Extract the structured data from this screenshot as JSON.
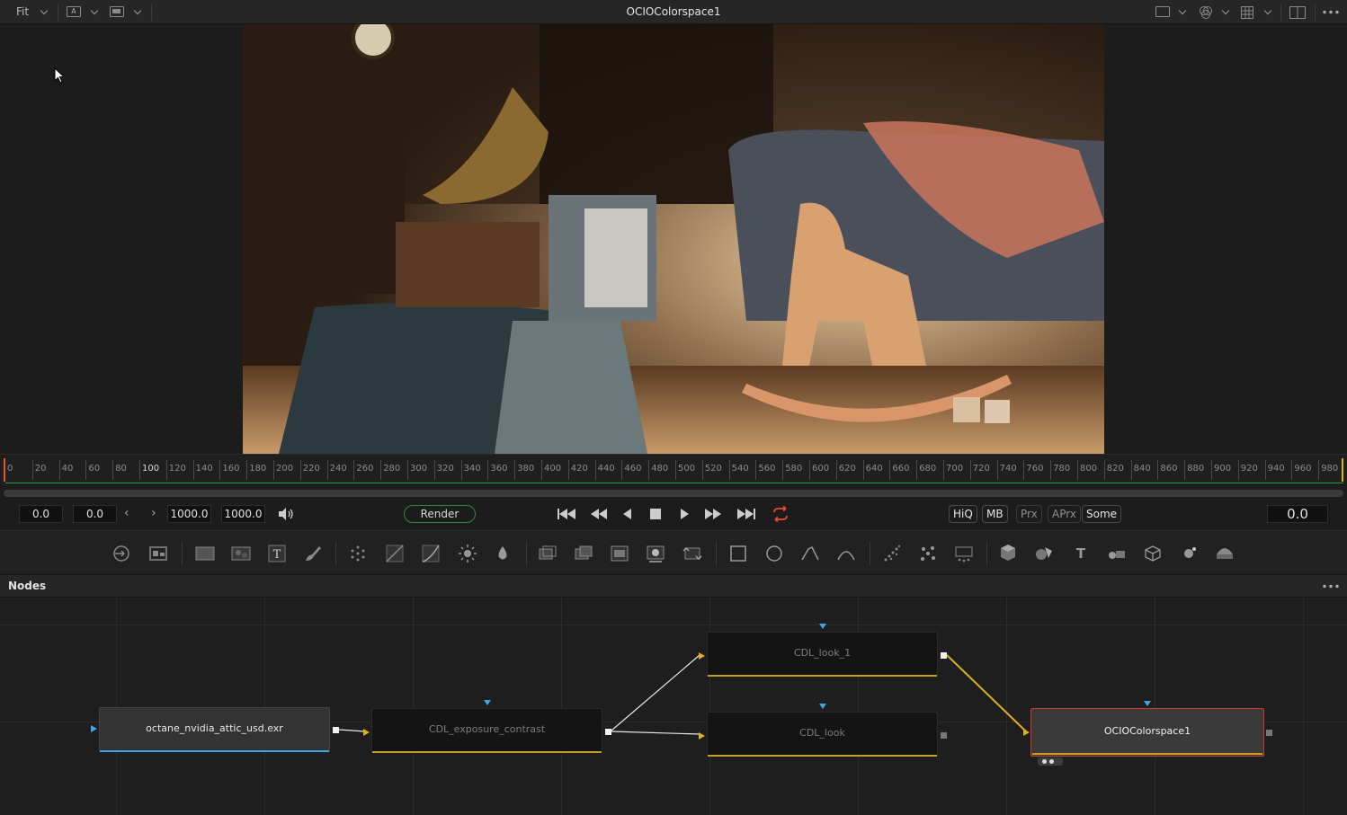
{
  "topbar": {
    "fit_label": "Fit",
    "title": "OCIOColorspace1"
  },
  "ruler": {
    "ticks": [
      "0",
      "20",
      "40",
      "60",
      "80",
      "100",
      "120",
      "140",
      "160",
      "180",
      "200",
      "220",
      "240",
      "260",
      "280",
      "300",
      "320",
      "340",
      "360",
      "380",
      "400",
      "420",
      "440",
      "460",
      "480",
      "500",
      "520",
      "540",
      "560",
      "580",
      "600",
      "620",
      "640",
      "660",
      "680",
      "700",
      "720",
      "740",
      "760",
      "780",
      "800",
      "820",
      "840",
      "860",
      "880",
      "900",
      "920",
      "940",
      "960",
      "980"
    ]
  },
  "transport": {
    "render_start": "0.0",
    "global_start": "0.0",
    "render_end": "1000.0",
    "global_end": "1000.0",
    "render_label": "Render",
    "hiq_label": "HiQ",
    "mb_label": "MB",
    "prx_label": "Prx",
    "aprx_label": "APrx",
    "some_label": "Some",
    "current_time": "0.0",
    "accent_colors": {
      "loop": "#e64a2e",
      "render_border": "#2f8a3c"
    }
  },
  "nodes_panel": {
    "title": "Nodes",
    "nodes": {
      "loader": "octane_nvidia_attic_usd.exr",
      "exposure": "CDL_exposure_contrast",
      "look1": "CDL_look_1",
      "look": "CDL_look",
      "ocio": "OCIOColorspace1"
    },
    "colors": {
      "selected_border": "#d9382c",
      "link": "#e0b020",
      "input": "#3fa6e6"
    }
  }
}
